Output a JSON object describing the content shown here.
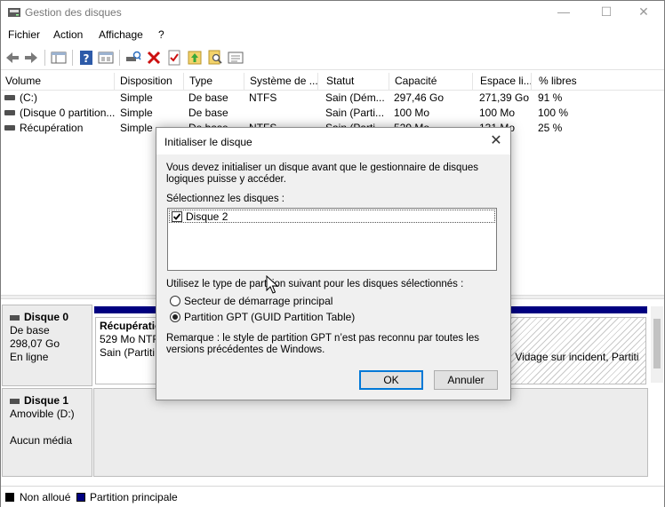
{
  "window": {
    "title": "Gestion des disques",
    "controls": {
      "minimize": "—",
      "maximize": "☐",
      "close": "✕"
    }
  },
  "menu": [
    "Fichier",
    "Action",
    "Affichage",
    "?"
  ],
  "toolbar": {
    "icons": [
      "back-arrow-icon",
      "forward-arrow-icon",
      "console-tree-icon",
      "help-icon",
      "properties-icon",
      "connect-icon",
      "delete-icon",
      "checkmark-icon",
      "folder-up-icon",
      "search-icon",
      "settings-icon"
    ]
  },
  "volume_table": {
    "columns": [
      "Volume",
      "Disposition",
      "Type",
      "Système de ...",
      "Statut",
      "Capacité",
      "Espace li...",
      "% libres"
    ],
    "rows": [
      [
        "(C:)",
        "Simple",
        "De base",
        "NTFS",
        "Sain (Dém...",
        "297,46 Go",
        "271,39 Go",
        "91 %"
      ],
      [
        "(Disque 0 partition...",
        "Simple",
        "De base",
        "",
        "Sain (Parti...",
        "100 Mo",
        "100 Mo",
        "100 %"
      ],
      [
        "Récupération",
        "Simple",
        "De base",
        "NTFS",
        "Sain (Parti...",
        "529 Mo",
        "131 Mo",
        "25 %"
      ]
    ]
  },
  "disks": [
    {
      "name": "Disque 0",
      "type": "De base",
      "size": "298,07 Go",
      "status": "En ligne",
      "partition": {
        "title": "Récupératio",
        "size": "529 Mo NTF",
        "status": "Sain (Partiti"
      },
      "partition_right": "e, Vidage sur incident, Partiti"
    },
    {
      "name": "Disque 1",
      "type": "Amovible (D:)",
      "media": "Aucun média"
    }
  ],
  "legend": [
    {
      "label": "Non alloué",
      "color": "#000000"
    },
    {
      "label": "Partition principale",
      "color": "#000080"
    }
  ],
  "dialog": {
    "title": "Initialiser le disque",
    "intro": "Vous devez initialiser un disque avant que le gestionnaire de disques logiques puisse y accéder.",
    "select_label": "Sélectionnez les disques :",
    "disk_item": "Disque 2",
    "disk_checked": true,
    "partition_prompt": "Utilisez le type de partition suivant pour les disques sélectionnés :",
    "options": [
      {
        "label": "Secteur de démarrage principal",
        "selected": false
      },
      {
        "label": "Partition GPT (GUID Partition Table)",
        "selected": true
      }
    ],
    "remark": "Remarque : le style de partition GPT n’est pas reconnu par toutes les versions précédentes de Windows.",
    "ok_label": "OK",
    "cancel_label": "Annuler"
  },
  "colors": {
    "primary_partition": "#000080",
    "focus_border": "#0078d7",
    "delete_red": "#cc1010"
  }
}
